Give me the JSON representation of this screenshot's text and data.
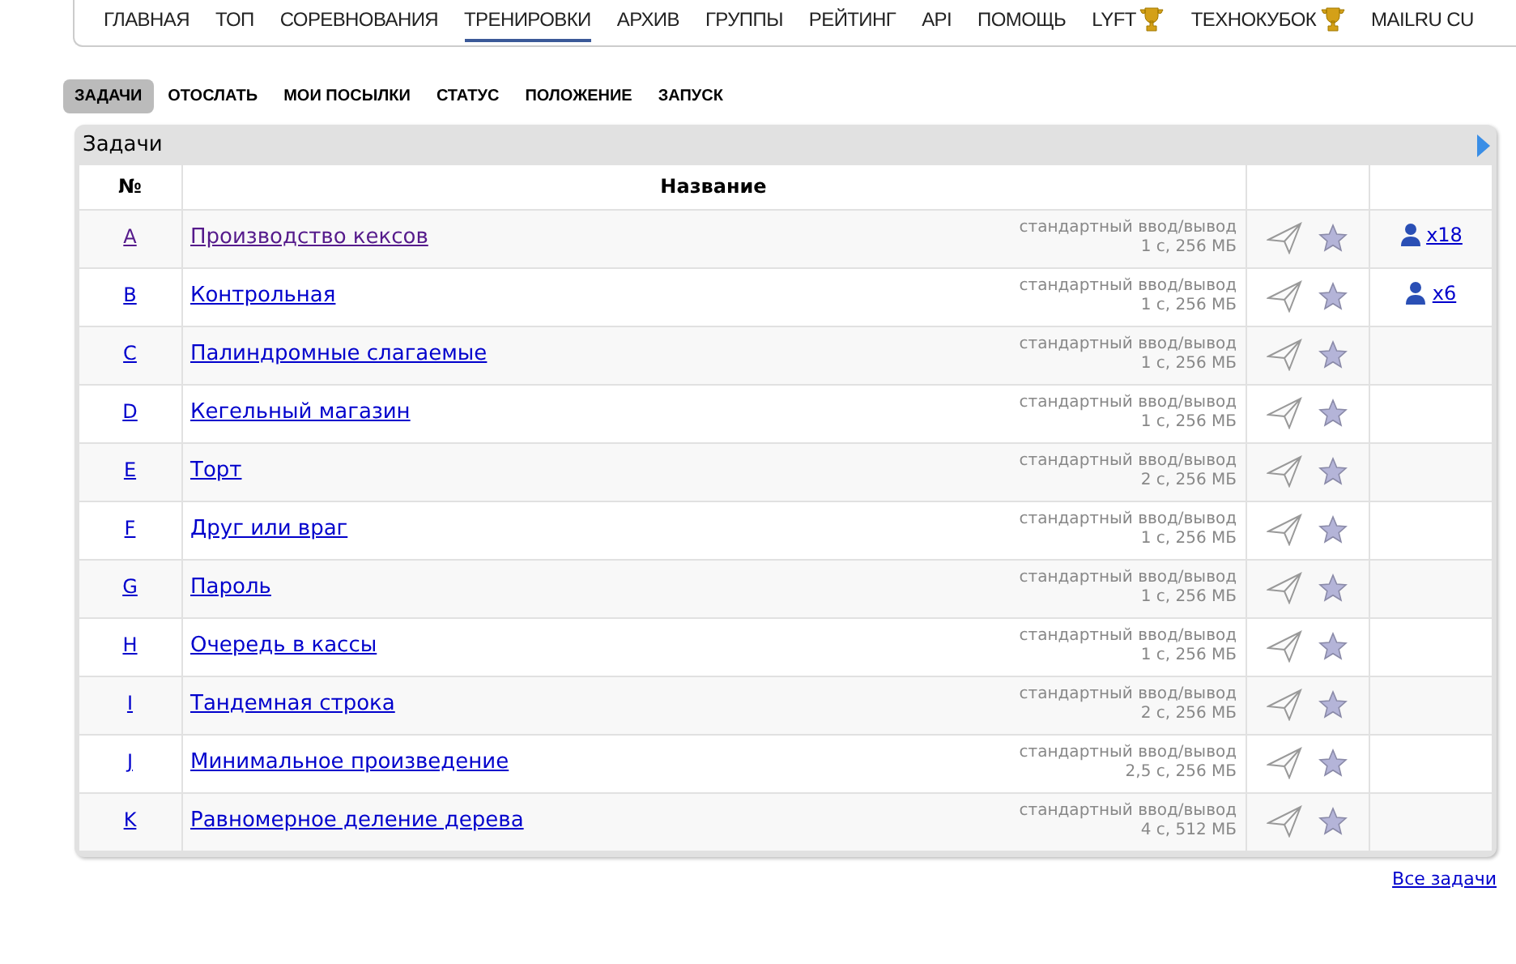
{
  "nav": [
    {
      "label": "ГЛАВНАЯ",
      "selected": false,
      "trophy": false
    },
    {
      "label": "ТОП",
      "selected": false,
      "trophy": false
    },
    {
      "label": "СОРЕВНОВАНИЯ",
      "selected": false,
      "trophy": false
    },
    {
      "label": "ТРЕНИРОВКИ",
      "selected": true,
      "trophy": false
    },
    {
      "label": "АРХИВ",
      "selected": false,
      "trophy": false
    },
    {
      "label": "ГРУППЫ",
      "selected": false,
      "trophy": false
    },
    {
      "label": "РЕЙТИНГ",
      "selected": false,
      "trophy": false
    },
    {
      "label": "API",
      "selected": false,
      "trophy": false
    },
    {
      "label": "ПОМОЩЬ",
      "selected": false,
      "trophy": false
    },
    {
      "label": "LYFT",
      "selected": false,
      "trophy": true
    },
    {
      "label": "ТЕХНОКУБОК",
      "selected": false,
      "trophy": true
    },
    {
      "label": "MAILRU CU",
      "selected": false,
      "trophy": false
    }
  ],
  "subnav": [
    {
      "label": "ЗАДАЧИ",
      "selected": true
    },
    {
      "label": "ОТОСЛАТЬ",
      "selected": false
    },
    {
      "label": "МОИ ПОСЫЛКИ",
      "selected": false
    },
    {
      "label": "СТАТУС",
      "selected": false
    },
    {
      "label": "ПОЛОЖЕНИЕ",
      "selected": false
    },
    {
      "label": "ЗАПУСК",
      "selected": false
    }
  ],
  "panel": {
    "title": "Задачи"
  },
  "table": {
    "columns": [
      "№",
      "Название"
    ],
    "rows": [
      {
        "index": "A",
        "name": "Производство кексов",
        "visited": true,
        "io": "стандартный ввод/вывод",
        "limits": "1 с, 256 МБ",
        "solved": "x18"
      },
      {
        "index": "B",
        "name": "Контрольная",
        "visited": false,
        "io": "стандартный ввод/вывод",
        "limits": "1 с, 256 МБ",
        "solved": "x6"
      },
      {
        "index": "C",
        "name": "Палиндромные слагаемые",
        "visited": false,
        "io": "стандартный ввод/вывод",
        "limits": "1 с, 256 МБ"
      },
      {
        "index": "D",
        "name": "Кегельный магазин",
        "visited": false,
        "io": "стандартный ввод/вывод",
        "limits": "1 с, 256 МБ"
      },
      {
        "index": "E",
        "name": "Торт",
        "visited": false,
        "io": "стандартный ввод/вывод",
        "limits": "2 с, 256 МБ"
      },
      {
        "index": "F",
        "name": "Друг или враг",
        "visited": false,
        "io": "стандартный ввод/вывод",
        "limits": "1 с, 256 МБ"
      },
      {
        "index": "G",
        "name": "Пароль",
        "visited": false,
        "io": "стандартный ввод/вывод",
        "limits": "1 с, 256 МБ"
      },
      {
        "index": "H",
        "name": "Очередь в кассы",
        "visited": false,
        "io": "стандартный ввод/вывод",
        "limits": "1 с, 256 МБ"
      },
      {
        "index": "I",
        "name": "Тандемная строка",
        "visited": false,
        "io": "стандартный ввод/вывод",
        "limits": "2 с, 256 МБ"
      },
      {
        "index": "J",
        "name": "Минимальное произведение",
        "visited": false,
        "io": "стандартный ввод/вывод",
        "limits": "2,5 с, 256 МБ"
      },
      {
        "index": "K",
        "name": "Равномерное деление дерева",
        "visited": false,
        "io": "стандартный ввод/вывод",
        "limits": "4 с, 512 МБ"
      }
    ]
  },
  "all_link": "Все задачи"
}
